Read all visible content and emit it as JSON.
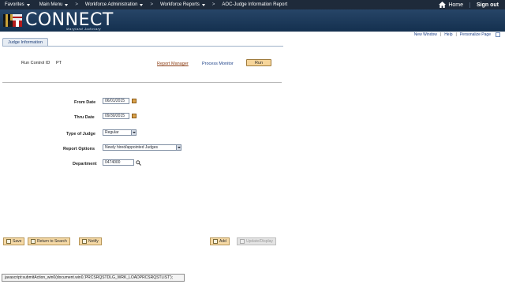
{
  "menu": {
    "favorites": "Favorites",
    "main_menu": "Main Menu",
    "breadcrumbs": [
      "Workforce Administration",
      "Workforce Reports",
      "AOC-Judge Information Report"
    ],
    "home": "Home",
    "sign_out": "Sign out"
  },
  "brand": {
    "name": "CONNECT",
    "subtitle": "Maryland Judiciary"
  },
  "utility_links": {
    "new_window": "New Window",
    "help": "Help",
    "personalize": "Personalize Page"
  },
  "tab": {
    "label": "Judge Information"
  },
  "run_control": {
    "label": "Run Control ID",
    "value": "PT",
    "report_manager": "Report Manager",
    "process_monitor": "Process Monitor",
    "run_button": "Run"
  },
  "form": {
    "from_date_label": "From Date",
    "from_date": "06/01/2015",
    "thru_date_label": "Thru Date",
    "thru_date": "09/30/2015",
    "type_of_judge_label": "Type of Judge",
    "type_of_judge": "Regular",
    "report_options_label": "Report Options",
    "report_options": "Newly hired/appointed Judges",
    "department_label": "Department",
    "department": "0474000"
  },
  "toolbar": {
    "save": "Save",
    "return_to_search": "Return to Search",
    "notify": "Notify",
    "add": "Add",
    "update_display": "Update/Display"
  },
  "status_bar": {
    "text": "javascript:submitAction_win0(document.win0,'PRCSRQSTDLG_WRK_LOADPRCSRQSTLIST');"
  }
}
